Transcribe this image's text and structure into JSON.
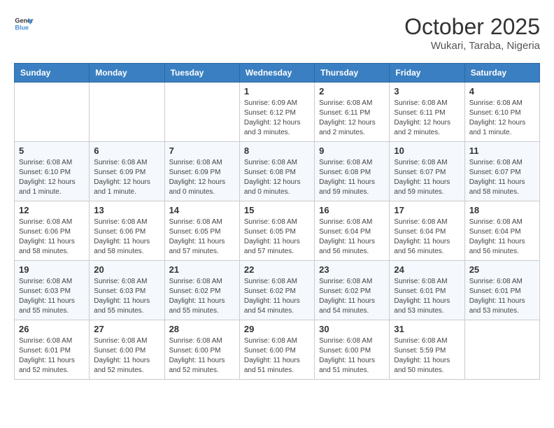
{
  "logo": {
    "line1": "General",
    "line2": "Blue"
  },
  "title": "October 2025",
  "location": "Wukari, Taraba, Nigeria",
  "days_header": [
    "Sunday",
    "Monday",
    "Tuesday",
    "Wednesday",
    "Thursday",
    "Friday",
    "Saturday"
  ],
  "weeks": [
    [
      {
        "num": "",
        "info": ""
      },
      {
        "num": "",
        "info": ""
      },
      {
        "num": "",
        "info": ""
      },
      {
        "num": "1",
        "info": "Sunrise: 6:09 AM\nSunset: 6:12 PM\nDaylight: 12 hours and 3 minutes."
      },
      {
        "num": "2",
        "info": "Sunrise: 6:08 AM\nSunset: 6:11 PM\nDaylight: 12 hours and 2 minutes."
      },
      {
        "num": "3",
        "info": "Sunrise: 6:08 AM\nSunset: 6:11 PM\nDaylight: 12 hours and 2 minutes."
      },
      {
        "num": "4",
        "info": "Sunrise: 6:08 AM\nSunset: 6:10 PM\nDaylight: 12 hours and 1 minute."
      }
    ],
    [
      {
        "num": "5",
        "info": "Sunrise: 6:08 AM\nSunset: 6:10 PM\nDaylight: 12 hours and 1 minute."
      },
      {
        "num": "6",
        "info": "Sunrise: 6:08 AM\nSunset: 6:09 PM\nDaylight: 12 hours and 1 minute."
      },
      {
        "num": "7",
        "info": "Sunrise: 6:08 AM\nSunset: 6:09 PM\nDaylight: 12 hours and 0 minutes."
      },
      {
        "num": "8",
        "info": "Sunrise: 6:08 AM\nSunset: 6:08 PM\nDaylight: 12 hours and 0 minutes."
      },
      {
        "num": "9",
        "info": "Sunrise: 6:08 AM\nSunset: 6:08 PM\nDaylight: 11 hours and 59 minutes."
      },
      {
        "num": "10",
        "info": "Sunrise: 6:08 AM\nSunset: 6:07 PM\nDaylight: 11 hours and 59 minutes."
      },
      {
        "num": "11",
        "info": "Sunrise: 6:08 AM\nSunset: 6:07 PM\nDaylight: 11 hours and 58 minutes."
      }
    ],
    [
      {
        "num": "12",
        "info": "Sunrise: 6:08 AM\nSunset: 6:06 PM\nDaylight: 11 hours and 58 minutes."
      },
      {
        "num": "13",
        "info": "Sunrise: 6:08 AM\nSunset: 6:06 PM\nDaylight: 11 hours and 58 minutes."
      },
      {
        "num": "14",
        "info": "Sunrise: 6:08 AM\nSunset: 6:05 PM\nDaylight: 11 hours and 57 minutes."
      },
      {
        "num": "15",
        "info": "Sunrise: 6:08 AM\nSunset: 6:05 PM\nDaylight: 11 hours and 57 minutes."
      },
      {
        "num": "16",
        "info": "Sunrise: 6:08 AM\nSunset: 6:04 PM\nDaylight: 11 hours and 56 minutes."
      },
      {
        "num": "17",
        "info": "Sunrise: 6:08 AM\nSunset: 6:04 PM\nDaylight: 11 hours and 56 minutes."
      },
      {
        "num": "18",
        "info": "Sunrise: 6:08 AM\nSunset: 6:04 PM\nDaylight: 11 hours and 56 minutes."
      }
    ],
    [
      {
        "num": "19",
        "info": "Sunrise: 6:08 AM\nSunset: 6:03 PM\nDaylight: 11 hours and 55 minutes."
      },
      {
        "num": "20",
        "info": "Sunrise: 6:08 AM\nSunset: 6:03 PM\nDaylight: 11 hours and 55 minutes."
      },
      {
        "num": "21",
        "info": "Sunrise: 6:08 AM\nSunset: 6:02 PM\nDaylight: 11 hours and 55 minutes."
      },
      {
        "num": "22",
        "info": "Sunrise: 6:08 AM\nSunset: 6:02 PM\nDaylight: 11 hours and 54 minutes."
      },
      {
        "num": "23",
        "info": "Sunrise: 6:08 AM\nSunset: 6:02 PM\nDaylight: 11 hours and 54 minutes."
      },
      {
        "num": "24",
        "info": "Sunrise: 6:08 AM\nSunset: 6:01 PM\nDaylight: 11 hours and 53 minutes."
      },
      {
        "num": "25",
        "info": "Sunrise: 6:08 AM\nSunset: 6:01 PM\nDaylight: 11 hours and 53 minutes."
      }
    ],
    [
      {
        "num": "26",
        "info": "Sunrise: 6:08 AM\nSunset: 6:01 PM\nDaylight: 11 hours and 52 minutes."
      },
      {
        "num": "27",
        "info": "Sunrise: 6:08 AM\nSunset: 6:00 PM\nDaylight: 11 hours and 52 minutes."
      },
      {
        "num": "28",
        "info": "Sunrise: 6:08 AM\nSunset: 6:00 PM\nDaylight: 11 hours and 52 minutes."
      },
      {
        "num": "29",
        "info": "Sunrise: 6:08 AM\nSunset: 6:00 PM\nDaylight: 11 hours and 51 minutes."
      },
      {
        "num": "30",
        "info": "Sunrise: 6:08 AM\nSunset: 6:00 PM\nDaylight: 11 hours and 51 minutes."
      },
      {
        "num": "31",
        "info": "Sunrise: 6:08 AM\nSunset: 5:59 PM\nDaylight: 11 hours and 50 minutes."
      },
      {
        "num": "",
        "info": ""
      }
    ]
  ]
}
